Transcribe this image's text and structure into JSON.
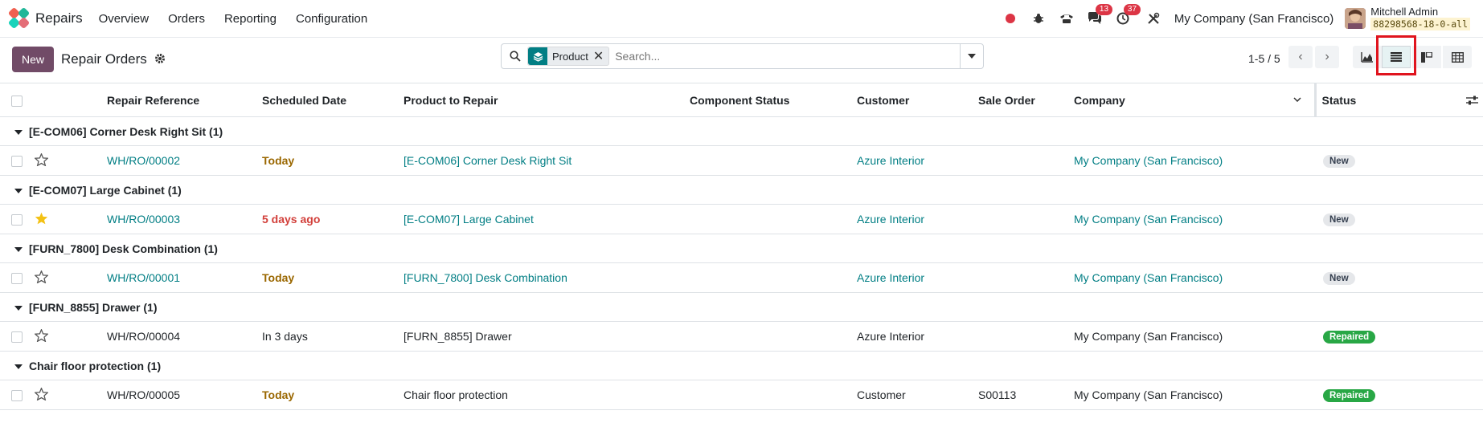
{
  "app": {
    "name": "Repairs"
  },
  "menu": [
    "Overview",
    "Orders",
    "Reporting",
    "Configuration"
  ],
  "topbar": {
    "messages_count": "13",
    "activities_count": "37",
    "company": "My Company (San Francisco)",
    "user_name": "Mitchell Admin",
    "db_name": "88298568-18-0-all"
  },
  "controls": {
    "new_label": "New",
    "title": "Repair Orders",
    "facet_label": "Product",
    "search_placeholder": "Search...",
    "pager": "1-5 / 5"
  },
  "columns": [
    "Repair Reference",
    "Scheduled Date",
    "Product to Repair",
    "Component Status",
    "Customer",
    "Sale Order",
    "Company",
    "Status"
  ],
  "groups": [
    {
      "label": "[E-COM06] Corner Desk Right Sit (1)",
      "row": {
        "ref": "WH/RO/00002",
        "date": "Today",
        "date_style": "warn",
        "product": "[E-COM06] Corner Desk Right Sit",
        "component": "",
        "customer": "Azure Interior",
        "sale_order": "",
        "company": "My Company (San Francisco)",
        "status": "New",
        "starred": false,
        "linked": true
      }
    },
    {
      "label": "[E-COM07] Large Cabinet (1)",
      "row": {
        "ref": "WH/RO/00003",
        "date": "5 days ago",
        "date_style": "danger",
        "product": "[E-COM07] Large Cabinet",
        "component": "",
        "customer": "Azure Interior",
        "sale_order": "",
        "company": "My Company (San Francisco)",
        "status": "New",
        "starred": true,
        "linked": true
      }
    },
    {
      "label": "[FURN_7800] Desk Combination (1)",
      "row": {
        "ref": "WH/RO/00001",
        "date": "Today",
        "date_style": "warn",
        "product": "[FURN_7800] Desk Combination",
        "component": "",
        "customer": "Azure Interior",
        "sale_order": "",
        "company": "My Company (San Francisco)",
        "status": "New",
        "starred": false,
        "linked": true
      }
    },
    {
      "label": "[FURN_8855] Drawer (1)",
      "row": {
        "ref": "WH/RO/00004",
        "date": "In 3 days",
        "date_style": "normal",
        "product": "[FURN_8855] Drawer",
        "component": "",
        "customer": "Azure Interior",
        "sale_order": "",
        "company": "My Company (San Francisco)",
        "status": "Repaired",
        "starred": false,
        "linked": false
      }
    },
    {
      "label": "Chair floor protection (1)",
      "row": {
        "ref": "WH/RO/00005",
        "date": "Today",
        "date_style": "warn",
        "product": "Chair floor protection",
        "component": "",
        "customer": "Customer",
        "sale_order": "S00113",
        "company": "My Company (San Francisco)",
        "status": "Repaired",
        "starred": false,
        "linked": false
      }
    }
  ],
  "colors": {
    "brand": "#714b67",
    "link": "#017e84",
    "highlight": "#e0141e"
  }
}
